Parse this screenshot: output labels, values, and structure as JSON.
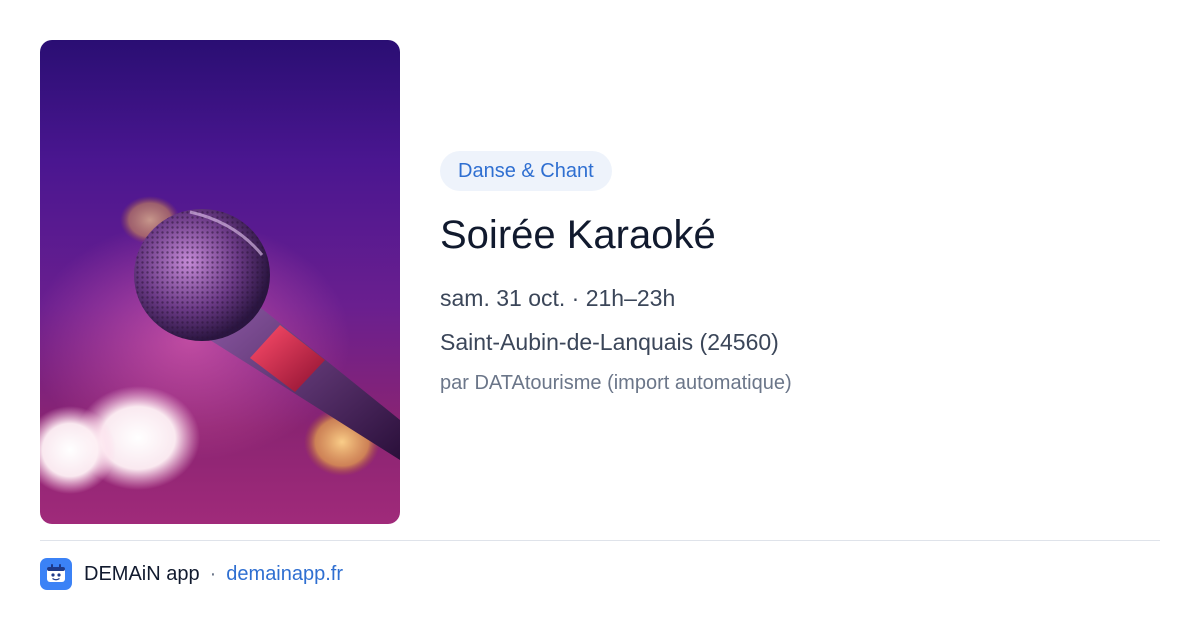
{
  "event": {
    "image_alt": "microphone",
    "category": "Danse & Chant",
    "title": "Soirée Karaoké",
    "datetime": "sam. 31 oct. · 21h–23h",
    "location": "Saint-Aubin-de-Lanquais (24560)",
    "source": "par DATAtourisme (import automatique)"
  },
  "footer": {
    "app_icon": "app-logo-icon",
    "app_name": "DEMAiN app",
    "separator": "·",
    "url": "demainapp.fr"
  },
  "colors": {
    "accent": "#2f6fd1",
    "tag_bg": "#eef3fb",
    "title": "#111a2e",
    "text": "#3b4659",
    "muted": "#6b7689"
  }
}
